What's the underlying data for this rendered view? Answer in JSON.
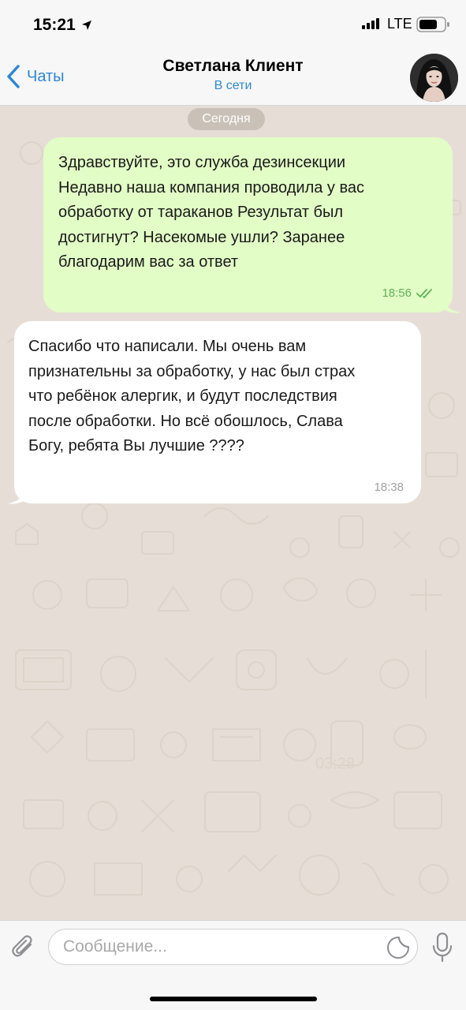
{
  "status_bar": {
    "time": "15:21",
    "network": "LTE",
    "icons": [
      "location-arrow-icon",
      "signal-bars-icon",
      "battery-icon"
    ]
  },
  "header": {
    "back_label": "Чаты",
    "contact_name": "Светлана Клиент",
    "contact_status": "В сети"
  },
  "chat": {
    "date_separator": "Сегодня",
    "messages": [
      {
        "direction": "outgoing",
        "lines": [
          "Здравствуйте, это служба дезинсекции",
          "Недавно наша компания проводила у вас",
          "обработку от тараканов Результат был",
          "достигнут? Насекомые ушли? Заранее",
          "благодарим вас за ответ"
        ],
        "time": "18:56",
        "status": "read"
      },
      {
        "direction": "incoming",
        "lines": [
          "Спасибо что написали. Мы очень вам",
          "признательны за обработку, у нас был страх",
          "что ребёнок алергик, и будут последствия",
          "после обработки. Но всё обошлось, Слава",
          "Богу, ребята Вы лучшие ????"
        ],
        "time": "18:38"
      }
    ]
  },
  "input": {
    "placeholder": "Сообщение..."
  },
  "colors": {
    "accent": "#2d87d8",
    "outgoing_bubble": "#e2fdc6",
    "incoming_bubble": "#ffffff",
    "chat_background": "#e6ded6",
    "read_check": "#5fb25a"
  }
}
